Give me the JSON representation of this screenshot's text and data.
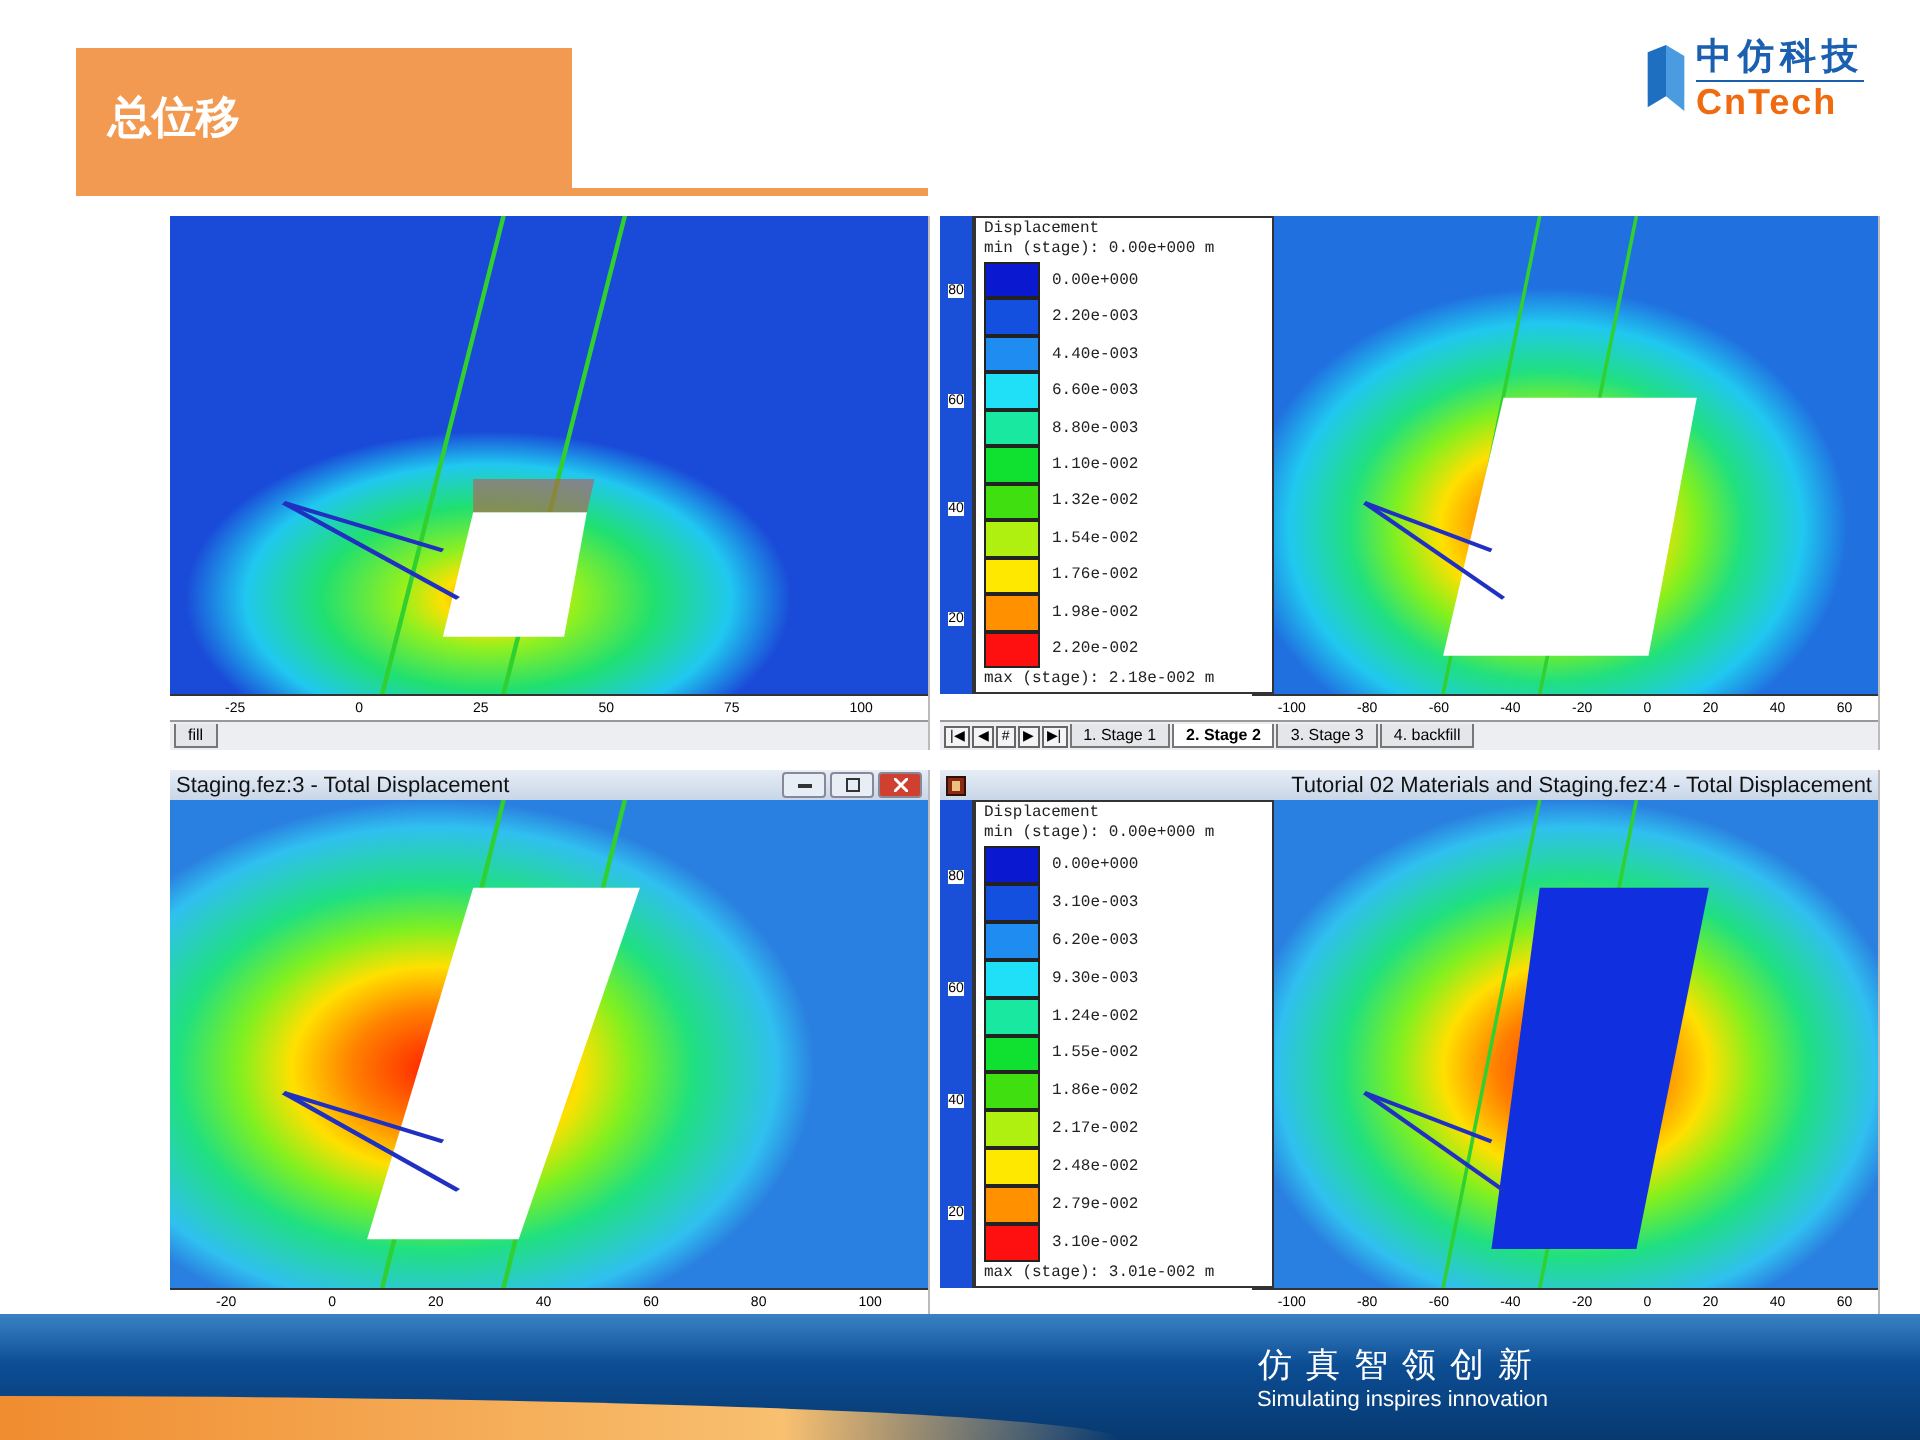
{
  "title": "总位移",
  "logo": {
    "cn": "中仿科技",
    "en": "CnTech"
  },
  "panels": [
    {
      "x_ticks": [
        "-25",
        "0",
        "25",
        "50",
        "75",
        "100"
      ],
      "stage_tabs": [
        {
          "label": "fill",
          "selected": false
        }
      ]
    },
    {
      "y_ticks": [
        "80",
        "60",
        "40",
        "20"
      ],
      "legend": {
        "title": "Displacement",
        "min": "min (stage): 0.00e+000 m",
        "max": "max (stage): 2.18e-002 m",
        "entries": [
          {
            "label": "0.00e+000",
            "color": "#0a18d0"
          },
          {
            "label": "2.20e-003",
            "color": "#1450e0"
          },
          {
            "label": "4.40e-003",
            "color": "#1e8cf0"
          },
          {
            "label": "6.60e-003",
            "color": "#20e0f8"
          },
          {
            "label": "8.80e-003",
            "color": "#18e8a0"
          },
          {
            "label": "1.10e-002",
            "color": "#10e030"
          },
          {
            "label": "1.32e-002",
            "color": "#40e010"
          },
          {
            "label": "1.54e-002",
            "color": "#b0f010"
          },
          {
            "label": "1.76e-002",
            "color": "#ffe800"
          },
          {
            "label": "1.98e-002",
            "color": "#ff9000"
          },
          {
            "label": "2.20e-002",
            "color": "#ff1010"
          }
        ]
      },
      "x_ticks": [
        "-100",
        "-80",
        "-60",
        "-40",
        "-20",
        "0",
        "20",
        "40",
        "60"
      ],
      "nav_buttons": [
        "|◀",
        "◀",
        "#",
        "▶",
        "▶|"
      ],
      "stage_tabs": [
        {
          "label": "1. Stage 1",
          "selected": false
        },
        {
          "label": "2. Stage 2",
          "selected": true
        },
        {
          "label": "3. Stage 3",
          "selected": false
        },
        {
          "label": "4. backfill",
          "selected": false
        }
      ]
    },
    {
      "window_title": "Staging.fez:3 - Total Displacement",
      "x_ticks": [
        "-20",
        "0",
        "20",
        "40",
        "60",
        "80",
        "100"
      ]
    },
    {
      "window_title": "Tutorial 02 Materials and Staging.fez:4 - Total Displacement",
      "y_ticks": [
        "80",
        "60",
        "40",
        "20"
      ],
      "legend": {
        "title": "Displacement",
        "min": "min (stage): 0.00e+000 m",
        "max": "max (stage): 3.01e-002 m",
        "entries": [
          {
            "label": "0.00e+000",
            "color": "#0a18d0"
          },
          {
            "label": "3.10e-003",
            "color": "#1450e0"
          },
          {
            "label": "6.20e-003",
            "color": "#1e8cf0"
          },
          {
            "label": "9.30e-003",
            "color": "#20e0f8"
          },
          {
            "label": "1.24e-002",
            "color": "#18e8a0"
          },
          {
            "label": "1.55e-002",
            "color": "#10e030"
          },
          {
            "label": "1.86e-002",
            "color": "#40e010"
          },
          {
            "label": "2.17e-002",
            "color": "#b0f010"
          },
          {
            "label": "2.48e-002",
            "color": "#ffe800"
          },
          {
            "label": "2.79e-002",
            "color": "#ff9000"
          },
          {
            "label": "3.10e-002",
            "color": "#ff1010"
          }
        ]
      },
      "x_ticks": [
        "-100",
        "-80",
        "-60",
        "-40",
        "-20",
        "0",
        "20",
        "40",
        "60"
      ]
    }
  ],
  "footer": {
    "cn": "仿真智领创新",
    "en": "Simulating inspires innovation"
  }
}
